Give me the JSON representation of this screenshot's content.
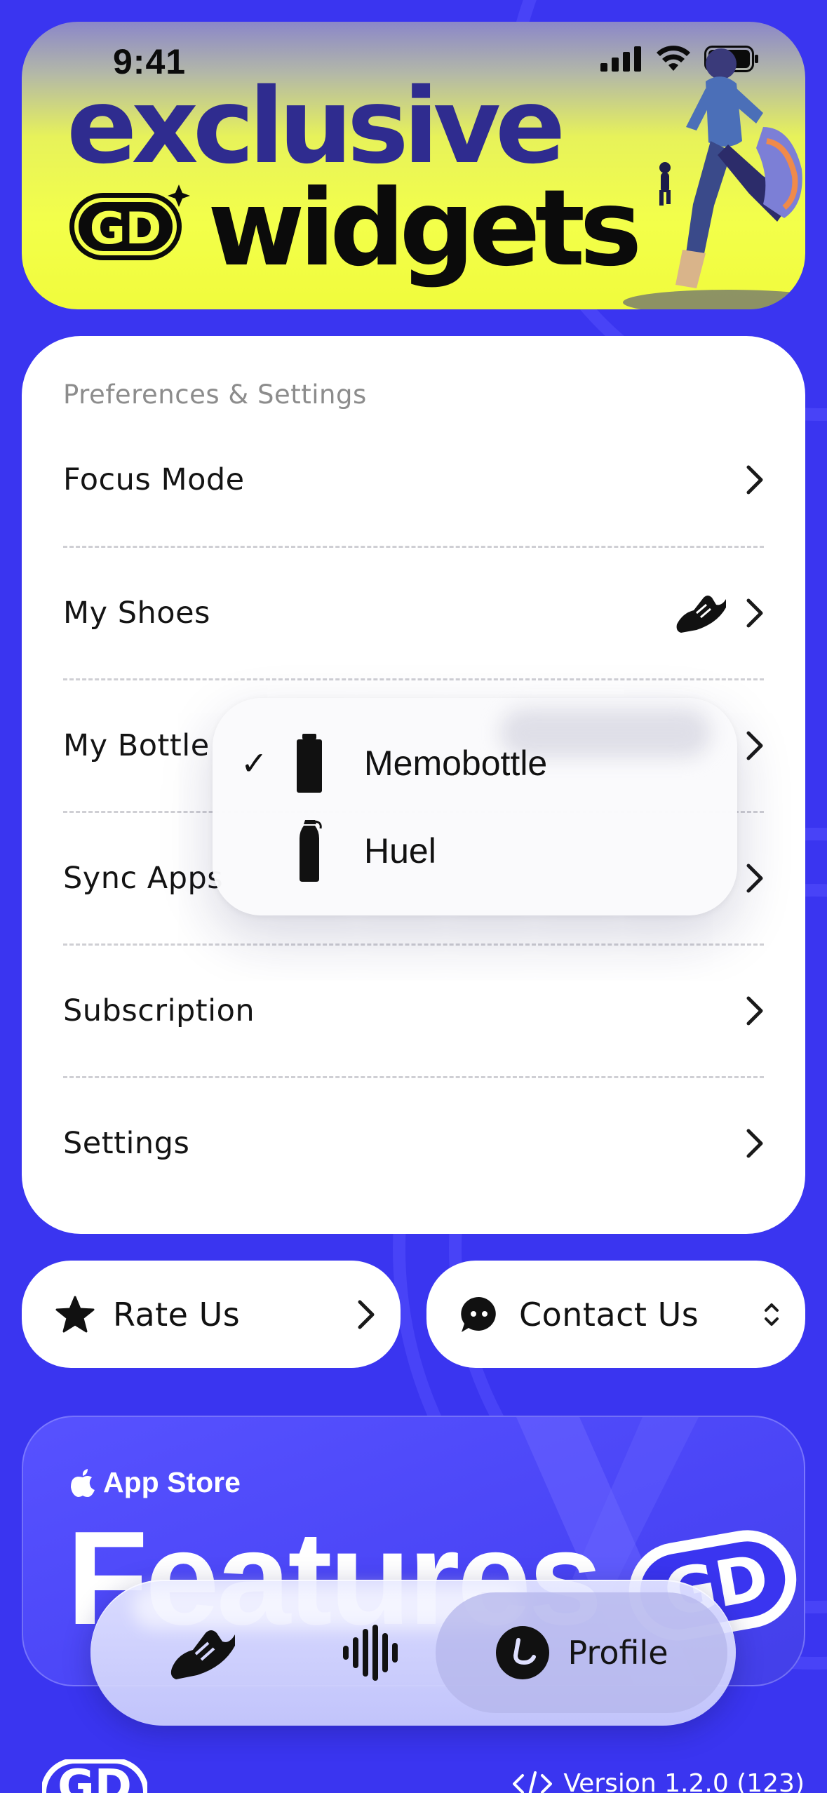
{
  "status_bar": {
    "time": "9:41"
  },
  "hero": {
    "title_line1": "exclusive",
    "title_line2": "widgets",
    "badge_text": "GD"
  },
  "settings": {
    "section_title": "Preferences & Settings",
    "rows": [
      {
        "label": "Focus Mode"
      },
      {
        "label": "My Shoes",
        "trailing_icon": "sneaker-icon"
      },
      {
        "label": "My Bottle"
      },
      {
        "label": "Sync Apps"
      },
      {
        "label": "Subscription"
      },
      {
        "label": "Settings"
      }
    ]
  },
  "bottle_menu": {
    "items": [
      {
        "label": "Memobottle",
        "selected": true,
        "icon": "flat-bottle-icon"
      },
      {
        "label": "Huel",
        "selected": false,
        "icon": "round-bottle-icon"
      }
    ],
    "check_mark": "✓"
  },
  "actions": {
    "rate_us": "Rate Us",
    "contact_us": "Contact Us"
  },
  "features_card": {
    "store_label": "App Store",
    "title": "Features"
  },
  "tab_bar": {
    "tabs": [
      {
        "name": "shoes",
        "icon": "sneaker-icon"
      },
      {
        "name": "audio",
        "icon": "waveform-icon"
      },
      {
        "name": "profile",
        "icon": "profile-icon",
        "label": "Profile",
        "active": true
      }
    ]
  },
  "footer": {
    "version": "Version 1.2.0 (123)"
  },
  "colors": {
    "background": "#3a35f0",
    "hero_yellow": "#f3ff4a",
    "hero_title_blue": "#2f2c8f",
    "card": "#ffffff",
    "secondary_text": "#8c8c8c"
  }
}
